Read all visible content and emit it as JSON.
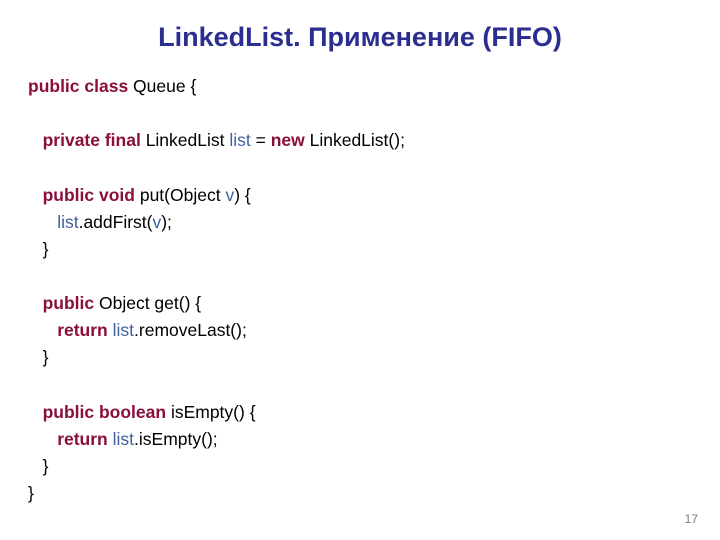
{
  "title": "LinkedList. Применение (FIFO)",
  "page_number": "17",
  "code": {
    "l1": {
      "kw1": "public class",
      "t1": " Queue {"
    },
    "l2": {
      "kw1": "private final",
      "t1": " LinkedList ",
      "id1": "list",
      "t2": " = ",
      "kw2": "new",
      "t3": " LinkedList();"
    },
    "l3": {
      "kw1": "public void",
      "t1": " put(Object ",
      "id1": "v",
      "t2": ") {"
    },
    "l4": {
      "id1": "list",
      "t1": ".addFirst(",
      "id2": "v",
      "t2": ");"
    },
    "l5": {
      "t1": "}"
    },
    "l6": {
      "kw1": "public",
      "t1": " Object get() {"
    },
    "l7": {
      "kw1": "return",
      "t1": " ",
      "id1": "list",
      "t2": ".removeLast();"
    },
    "l8": {
      "t1": "}"
    },
    "l9": {
      "kw1": "public boolean",
      "t1": " isEmpty() {"
    },
    "l10": {
      "kw1": "return",
      "t1": " ",
      "id1": "list",
      "t2": ".isEmpty();"
    },
    "l11": {
      "t1": "}"
    },
    "l12": {
      "t1": "}"
    }
  }
}
